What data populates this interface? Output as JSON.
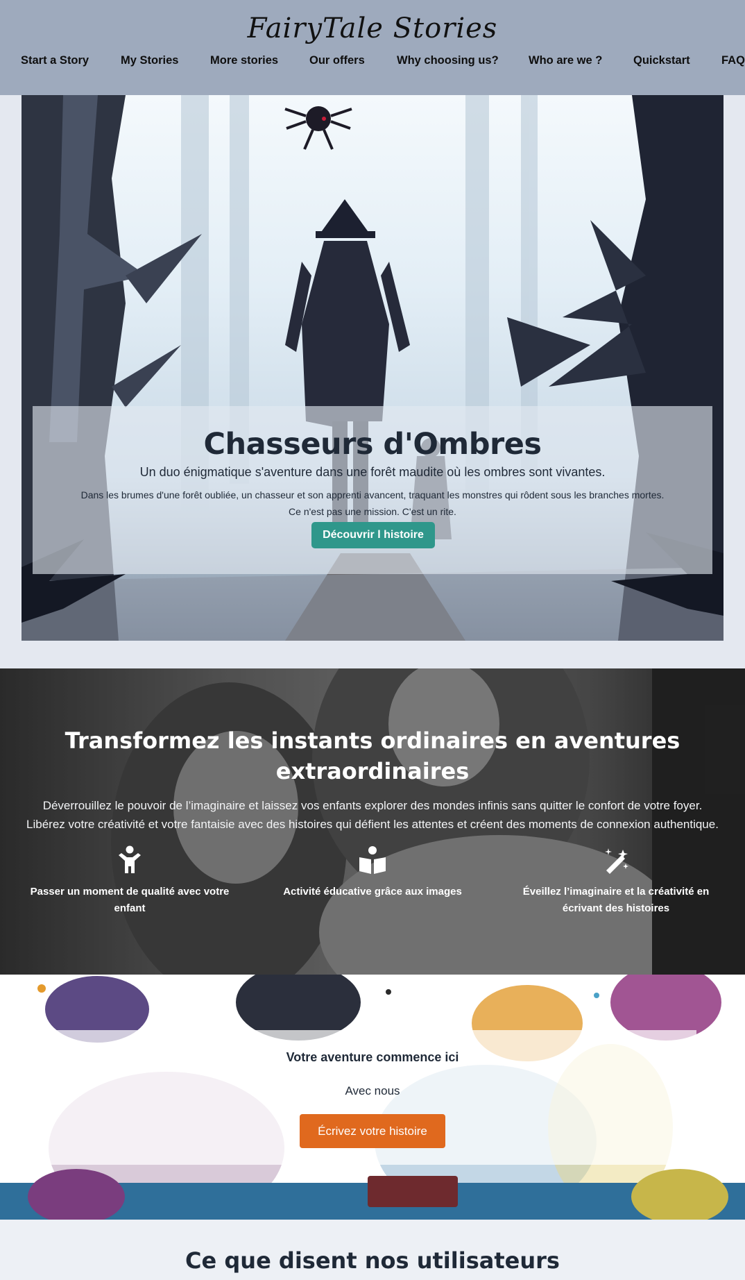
{
  "header": {
    "logo": "FairyTale Stories",
    "nav": [
      "Start a Story",
      "My Stories",
      "More stories",
      "Our offers",
      "Why choosing us?",
      "Who are we ?",
      "Quickstart",
      "FAQ"
    ]
  },
  "hero": {
    "title": "Chasseurs d'Ombres",
    "subtitle": "Un duo énigmatique s'aventure dans une forêt maudite où les ombres sont vivantes.",
    "text_line1": "Dans les brumes d'une forêt oubliée, un chasseur et son apprenti avancent, traquant les monstres qui rôdent sous les branches mortes.",
    "text_line2": "Ce n'est pas une mission. C'est un rite.",
    "button": "Découvrir l histoire"
  },
  "transform": {
    "title_line1": "Transformez les instants ordinaires en aventures",
    "title_line2": "extraordinaires",
    "text_line1": "Déverrouillez le pouvoir de l’imaginaire et laissez vos enfants explorer des mondes infinis sans quitter le confort de votre foyer.",
    "text_line2": "Libérez votre créativité et votre fantaisie avec des histoires qui défient les attentes et créent des moments de connexion authentique.",
    "features": [
      {
        "icon": "child-icon",
        "line1": "Passer un moment de qualité avec votre",
        "line2": "enfant"
      },
      {
        "icon": "book-reader-icon",
        "line1": "Activité éducative grâce aux images",
        "line2": ""
      },
      {
        "icon": "magic-wand-icon",
        "line1": "Éveillez l’imaginaire et la créativité en",
        "line2": "écrivant des histoires"
      }
    ]
  },
  "adventure": {
    "title": "Votre aventure commence ici",
    "subtitle": "Avec nous",
    "button": "Écrivez votre histoire"
  },
  "testimonials": {
    "title": "Ce que disent nos utilisateurs"
  },
  "colors": {
    "header_bg": "#9eaabd",
    "hero_button": "#2f978b",
    "cta_button": "#e0691e",
    "page_bg": "#e4e8f0"
  }
}
